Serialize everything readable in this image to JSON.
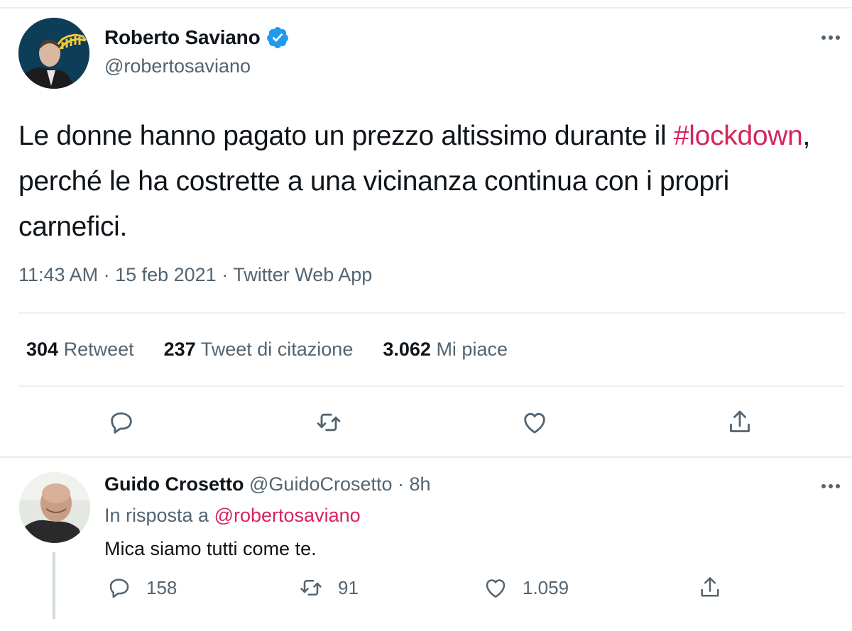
{
  "tweet": {
    "author_name": "Roberto Saviano",
    "author_handle": "@robertosaviano",
    "text_before": "Le donne hanno pagato un prezzo altissimo durante il ",
    "hashtag": "#lockdown",
    "text_after": ", perché le ha costrette a una vicinanza continua con i propri carnefici.",
    "meta": "11:43 AM · 15 feb 2021 · Twitter Web App",
    "stats": {
      "retweets_count": "304",
      "retweets_label": "Retweet",
      "quotes_count": "237",
      "quotes_label": "Tweet di citazione",
      "likes_count": "3.062",
      "likes_label": "Mi piace"
    },
    "icons": [
      "more-icon",
      "verified-badge-icon",
      "reply-icon",
      "retweet-icon",
      "like-icon",
      "share-icon"
    ]
  },
  "reply": {
    "author_name": "Guido Crosetto",
    "author_handle": "@GuidoCrosetto",
    "time": "· 8h",
    "in_reply_to_label": "In risposta a",
    "in_reply_to_handle": "@robertosaviano",
    "text": "Mica siamo tutti come te.",
    "replies": "158",
    "retweets": "91",
    "likes": "1.059"
  },
  "colors": {
    "hashtag": "#d6245b",
    "verified": "#1d9bf0",
    "secondary_text": "#536471",
    "icon_gray": "#536471"
  }
}
